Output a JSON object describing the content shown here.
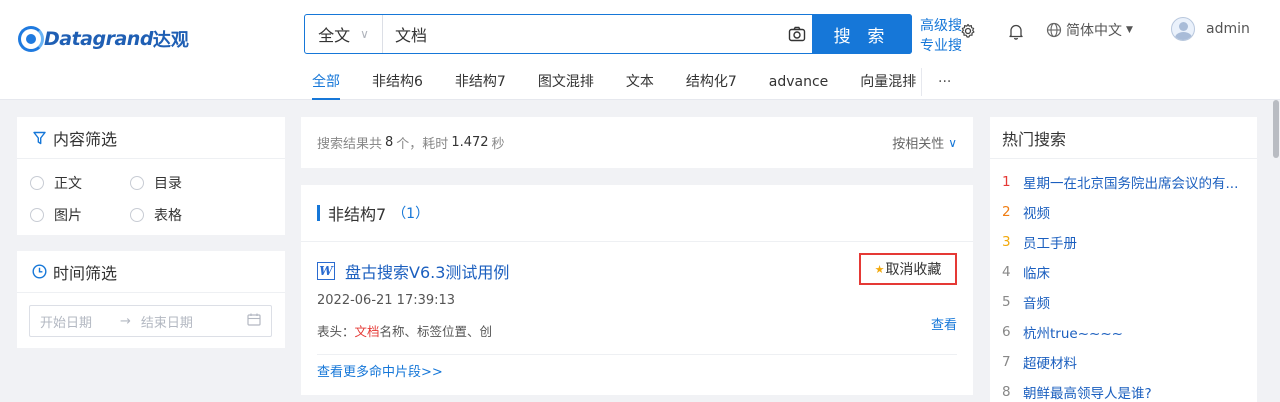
{
  "brand": {
    "logo_text": "Datagrand",
    "logo_cn": "达观"
  },
  "search": {
    "scope": "全文",
    "query": "文档",
    "button": "搜 索",
    "advanced": "高级搜索",
    "professional": "专业搜索"
  },
  "header": {
    "language": "简体中文",
    "username": "admin"
  },
  "tabs": [
    {
      "label": "全部",
      "active": true
    },
    {
      "label": "非结构6"
    },
    {
      "label": "非结构7"
    },
    {
      "label": "图文混排"
    },
    {
      "label": "文本"
    },
    {
      "label": "结构化7"
    },
    {
      "label": "advance"
    },
    {
      "label": "向量混排"
    }
  ],
  "more_tabs": "···",
  "content_filter": {
    "title": "内容筛选",
    "options": [
      "正文",
      "目录",
      "图片",
      "表格"
    ]
  },
  "time_filter": {
    "title": "时间筛选",
    "start_placeholder": "开始日期",
    "separator": "→",
    "end_placeholder": "结束日期"
  },
  "results_bar": {
    "prefix": "搜索结果共",
    "count": "8",
    "mid": "个，耗时",
    "time": "1.472",
    "suffix": "秒",
    "sort": "按相关性"
  },
  "group": {
    "name": "非结构7",
    "count": "（1）",
    "item": {
      "title": "盘古搜索V6.3测试用例",
      "favorite_label": "取消收藏",
      "date": "2022-06-21 17:39:13",
      "snippet_prefix": "表头：",
      "snippet_highlight": "文档",
      "snippet_rest": "名称、标签位置、创",
      "view": "查看"
    },
    "more": "查看更多命中片段>>"
  },
  "hot_search": {
    "title": "热门搜索",
    "items": [
      {
        "rank": "1",
        "text": "星期一在北京国务院出席会议的有..."
      },
      {
        "rank": "2",
        "text": "视频"
      },
      {
        "rank": "3",
        "text": "员工手册"
      },
      {
        "rank": "4",
        "text": "临床"
      },
      {
        "rank": "5",
        "text": "音频"
      },
      {
        "rank": "6",
        "text": "杭州true~~~~"
      },
      {
        "rank": "7",
        "text": "超硬材料"
      },
      {
        "rank": "8",
        "text": "朝鲜最高领导人是谁?"
      }
    ]
  },
  "icons": {
    "camera": "camera-icon",
    "settings": "gear-icon",
    "notifications": "bell-icon",
    "language": "globe-icon",
    "filter": "funnel-icon",
    "time": "clock-icon",
    "calendar": "calendar-icon",
    "favorite": "star-icon",
    "document": "word-doc-icon"
  },
  "colors": {
    "accent": "#1677d8",
    "highlight": "#e53935",
    "favorite_box": "#e53935"
  }
}
